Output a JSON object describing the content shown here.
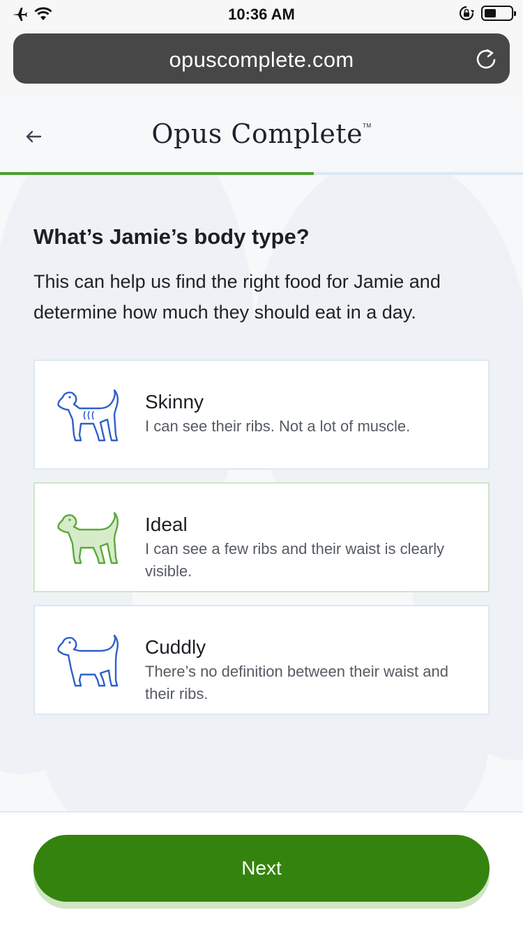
{
  "status_bar": {
    "time": "10:36 AM",
    "icons": [
      "airplane-icon",
      "wifi-icon",
      "rotation-lock-icon",
      "battery-icon"
    ]
  },
  "browser": {
    "url": "opuscomplete.com",
    "reload_icon": "reload-icon"
  },
  "header": {
    "back_icon": "back-arrow-icon",
    "logo": "Opus Complete",
    "logo_mark": "TM",
    "progress_percent": 60
  },
  "main": {
    "question": "What’s Jamie’s body type?",
    "helper": "This can help us find the right food for Jamie and determine how much they should eat in a day.",
    "options": [
      {
        "title": "Skinny",
        "description": "I can see their ribs. Not a lot of muscle.",
        "icon": "skinny-dog-icon",
        "selected": false
      },
      {
        "title": "Ideal",
        "description": "I can see a few ribs and their waist is clearly visible.",
        "icon": "ideal-dog-icon",
        "selected": true
      },
      {
        "title": "Cuddly",
        "description": "There’s no definition between their waist and their ribs.",
        "icon": "cuddly-dog-icon",
        "selected": false
      }
    ]
  },
  "footer": {
    "next_label": "Next"
  },
  "colors": {
    "brand_green": "#35830f",
    "progress_green": "#48a12a",
    "icon_blue": "#2f5fc9",
    "icon_green": "#5aa83a"
  }
}
